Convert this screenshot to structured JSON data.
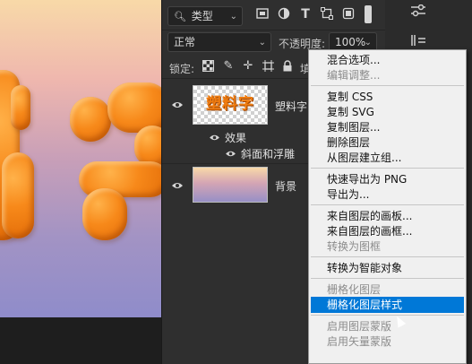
{
  "filter": {
    "kind_label": "类型"
  },
  "filter_icons": [
    "image-filter-icon",
    "adjustment-filter-icon",
    "text-filter-icon",
    "shape-filter-icon",
    "smart-object-filter-icon"
  ],
  "blend": {
    "mode": "正常",
    "opacity_label": "不透明度:",
    "opacity_value": "100%"
  },
  "lock": {
    "label": "锁定:",
    "fill_label_partial": "填"
  },
  "layers": [
    {
      "name": "塑料字",
      "thumb_text": "塑料字",
      "effects_label": "效果",
      "effect_item": "斜面和浮雕"
    },
    {
      "name": "背景"
    }
  ],
  "context_menu": {
    "items": [
      {
        "label": "混合选项...",
        "disabled": false
      },
      {
        "label": "编辑调整...",
        "disabled": true
      },
      {
        "sep": true
      },
      {
        "label": "复制 CSS",
        "disabled": false
      },
      {
        "label": "复制 SVG",
        "disabled": false
      },
      {
        "label": "复制图层...",
        "disabled": false
      },
      {
        "label": "删除图层",
        "disabled": false
      },
      {
        "label": "从图层建立组...",
        "disabled": false
      },
      {
        "sep": true
      },
      {
        "label": "快速导出为 PNG",
        "disabled": false
      },
      {
        "label": "导出为...",
        "disabled": false
      },
      {
        "sep": true
      },
      {
        "label": "来自图层的画板...",
        "disabled": false
      },
      {
        "label": "来自图层的画框...",
        "disabled": false
      },
      {
        "label": "转换为图框",
        "disabled": true
      },
      {
        "sep": true
      },
      {
        "label": "转换为智能对象",
        "disabled": false
      },
      {
        "sep": true
      },
      {
        "label": "栅格化图层",
        "disabled": true
      },
      {
        "label": "栅格化图层样式",
        "disabled": false,
        "highlighted": true
      },
      {
        "sep": true
      },
      {
        "label": "启用图层蒙版",
        "disabled": true
      },
      {
        "label": "启用矢量蒙版",
        "disabled": true
      }
    ]
  },
  "colors": {
    "accent": "#0078d7",
    "text_orange": "#f07d10",
    "panel_bg": "#2f2f2f"
  }
}
